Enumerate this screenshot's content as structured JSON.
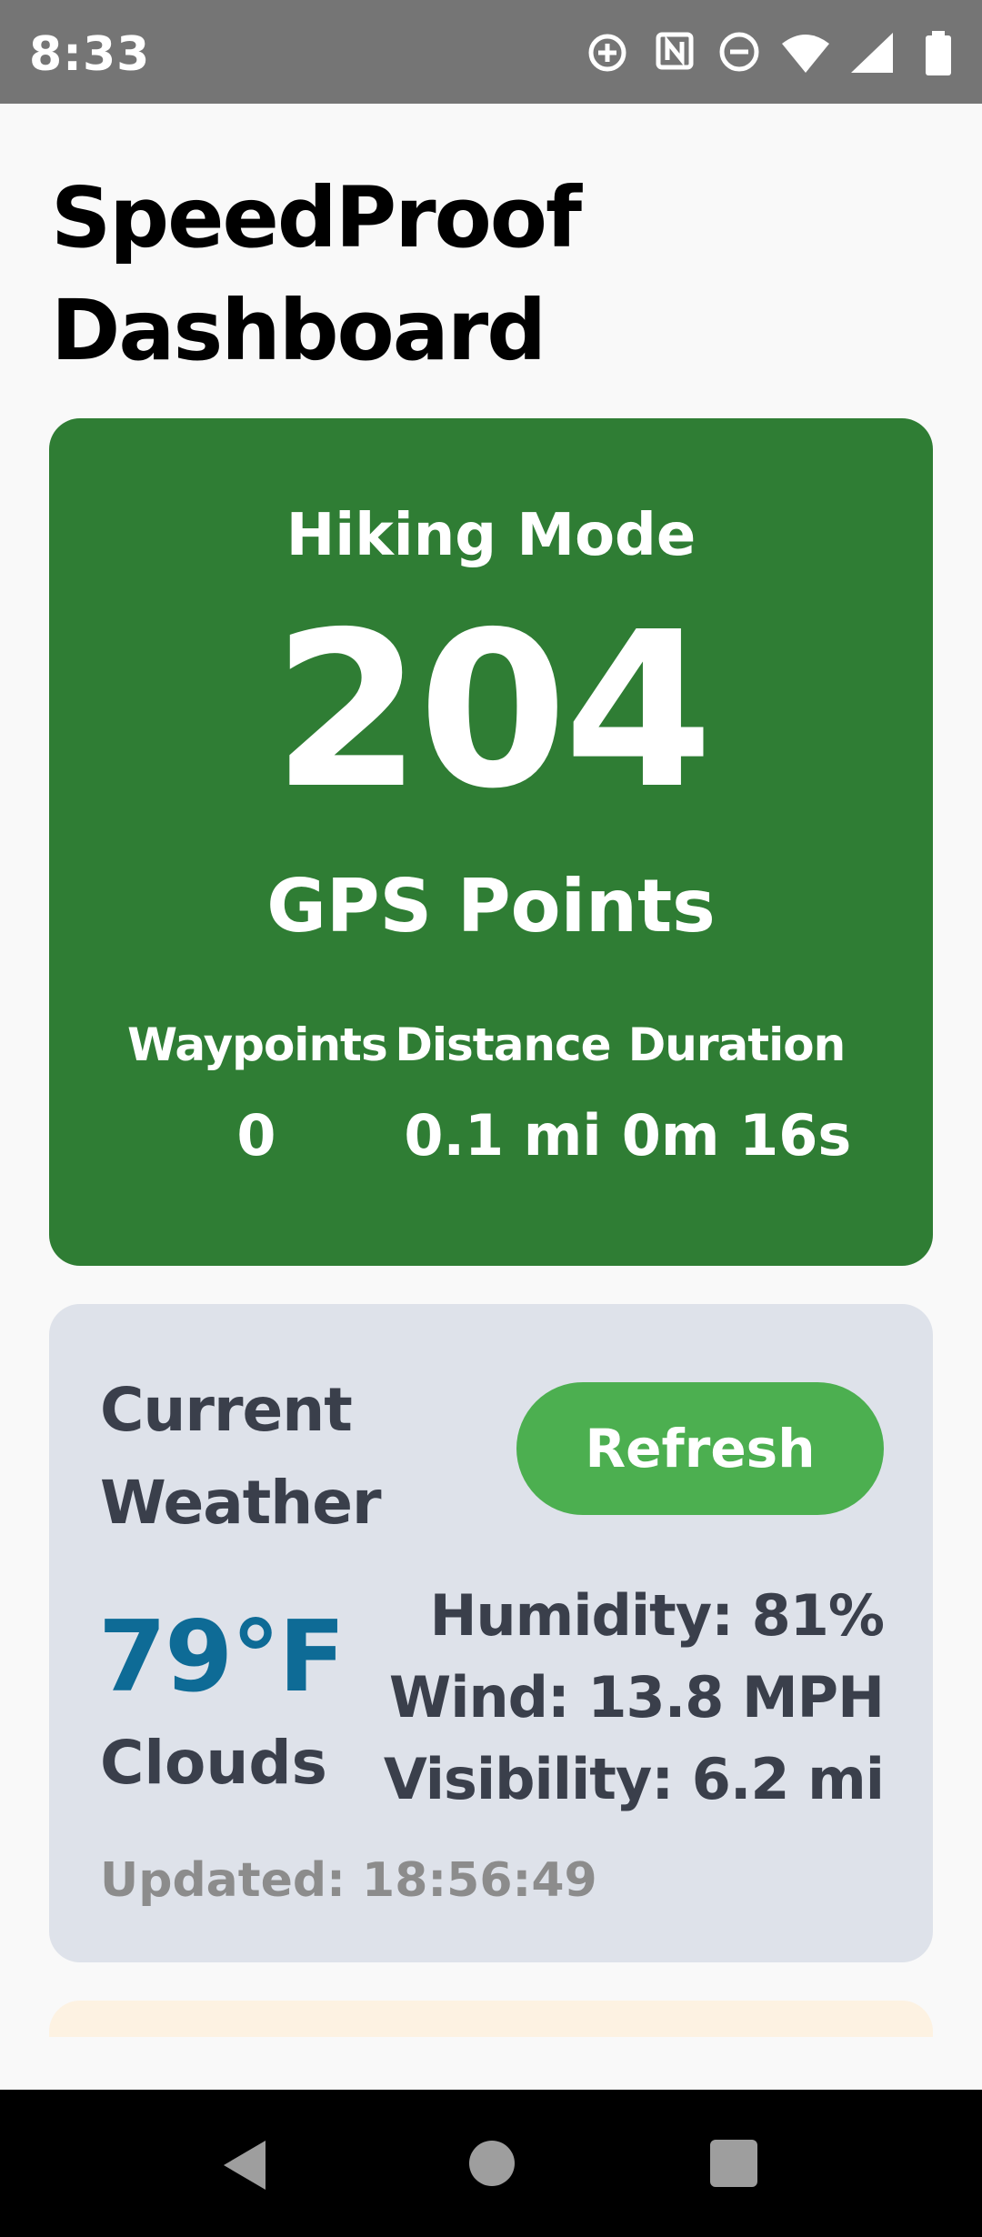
{
  "status_bar": {
    "time": "8:33",
    "icons": [
      "add-circle-icon",
      "nfc-icon",
      "do-not-disturb-icon",
      "wifi-icon",
      "signal-icon",
      "battery-icon"
    ]
  },
  "page": {
    "title": "SpeedProof Dashboard"
  },
  "tracking": {
    "mode": "Hiking Mode",
    "gps_count": "204",
    "gps_label": "GPS Points",
    "stats": [
      {
        "label": "Waypoints",
        "value": "0"
      },
      {
        "label": "Distance",
        "value": "0.1 mi"
      },
      {
        "label": "Duration",
        "value": "0m 16s"
      }
    ],
    "accent": "#2f7d34"
  },
  "weather": {
    "title_line1": "Current",
    "title_line2": "Weather",
    "refresh_label": "Refresh",
    "temperature": "79°F",
    "condition": "Clouds",
    "humidity": "Humidity: 81%",
    "wind": "Wind: 13.8 MPH",
    "visibility": "Visibility: 6.2 mi",
    "updated": "Updated: 18:56:49",
    "colors": {
      "card": "#dee2ea",
      "temperature": "#0e6b96",
      "button": "#4caf50"
    }
  },
  "nav_bar": {
    "icons": [
      "back-icon",
      "home-icon",
      "recents-icon"
    ]
  }
}
